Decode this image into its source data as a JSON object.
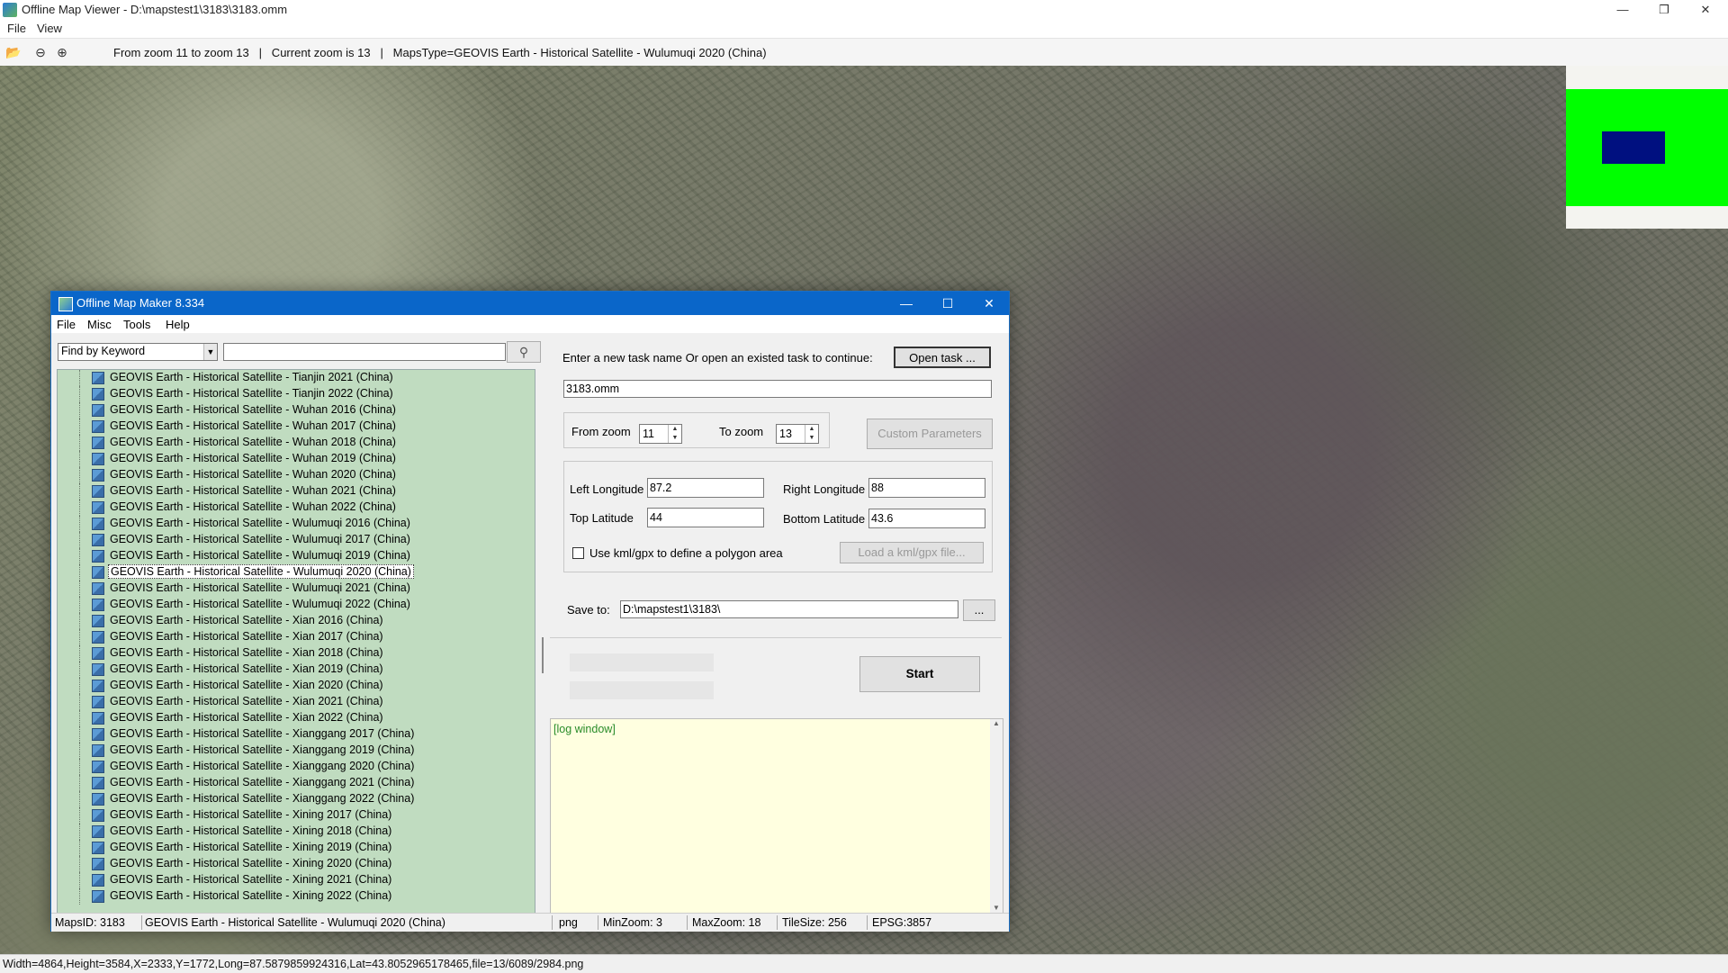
{
  "outer": {
    "title": "Offline Map Viewer - D:\\mapstest1\\3183\\3183.omm",
    "menu": [
      "File",
      "View"
    ],
    "toolbar_status": "From zoom 11 to zoom 13   |   Current zoom is 13   |   MapsType=GEOVIS Earth - Historical Satellite - Wulumuqi 2020 (China)",
    "statusbar": "Width=4864,Height=3584,X=2333,Y=1772,Long=87.5879859924316,Lat=43.8052965178465,file=13/6089/2984.png",
    "controls": [
      "—",
      "❐",
      "✕"
    ]
  },
  "overview": {
    "frame_color": "#00ff00",
    "viewport_color": "#001080"
  },
  "dialog": {
    "title": "Offline Map Maker 8.334",
    "menu": [
      "File",
      "Misc",
      "Tools",
      "Help"
    ],
    "controls": [
      "—",
      "☐",
      "✕"
    ],
    "find": {
      "mode": "Find by Keyword",
      "query": ""
    },
    "tree_items": [
      "GEOVIS Earth - Historical Satellite - Tianjin 2021 (China)",
      "GEOVIS Earth - Historical Satellite - Tianjin 2022 (China)",
      "GEOVIS Earth - Historical Satellite - Wuhan 2016 (China)",
      "GEOVIS Earth - Historical Satellite - Wuhan 2017 (China)",
      "GEOVIS Earth - Historical Satellite - Wuhan 2018 (China)",
      "GEOVIS Earth - Historical Satellite - Wuhan 2019 (China)",
      "GEOVIS Earth - Historical Satellite - Wuhan 2020 (China)",
      "GEOVIS Earth - Historical Satellite - Wuhan 2021 (China)",
      "GEOVIS Earth - Historical Satellite - Wuhan 2022 (China)",
      "GEOVIS Earth - Historical Satellite - Wulumuqi 2016 (China)",
      "GEOVIS Earth - Historical Satellite - Wulumuqi 2017 (China)",
      "GEOVIS Earth - Historical Satellite - Wulumuqi 2019 (China)",
      "GEOVIS Earth - Historical Satellite - Wulumuqi 2020 (China)",
      "GEOVIS Earth - Historical Satellite - Wulumuqi 2021 (China)",
      "GEOVIS Earth - Historical Satellite - Wulumuqi 2022 (China)",
      "GEOVIS Earth - Historical Satellite - Xian 2016 (China)",
      "GEOVIS Earth - Historical Satellite - Xian 2017 (China)",
      "GEOVIS Earth - Historical Satellite - Xian 2018 (China)",
      "GEOVIS Earth - Historical Satellite - Xian 2019 (China)",
      "GEOVIS Earth - Historical Satellite - Xian 2020 (China)",
      "GEOVIS Earth - Historical Satellite - Xian 2021 (China)",
      "GEOVIS Earth - Historical Satellite - Xian 2022 (China)",
      "GEOVIS Earth - Historical Satellite - Xianggang 2017 (China)",
      "GEOVIS Earth - Historical Satellite - Xianggang 2019 (China)",
      "GEOVIS Earth - Historical Satellite - Xianggang 2020 (China)",
      "GEOVIS Earth - Historical Satellite - Xianggang 2021 (China)",
      "GEOVIS Earth - Historical Satellite - Xianggang 2022 (China)",
      "GEOVIS Earth - Historical Satellite - Xining 2017 (China)",
      "GEOVIS Earth - Historical Satellite - Xining 2018 (China)",
      "GEOVIS Earth - Historical Satellite - Xining 2019 (China)",
      "GEOVIS Earth - Historical Satellite - Xining 2020 (China)",
      "GEOVIS Earth - Historical Satellite - Xining 2021 (China)",
      "GEOVIS Earth - Historical Satellite - Xining 2022 (China)"
    ],
    "selected_item": "GEOVIS Earth - Historical Satellite - Wulumuqi 2020 (China)",
    "task_prompt": "Enter a new task name Or open an existed task to continue:",
    "open_task_label": "Open task ...",
    "task_name": "3183.omm",
    "from_zoom_label": "From zoom",
    "from_zoom": "11",
    "to_zoom_label": "To zoom",
    "to_zoom": "13",
    "custom_params_label": "Custom Parameters",
    "left_lon_label": "Left Longitude",
    "left_lon": "87.2",
    "right_lon_label": "Right Longitude",
    "right_lon": "88",
    "top_lat_label": "Top Latitude",
    "top_lat": "44",
    "bottom_lat_label": "Bottom Latitude",
    "bottom_lat": "43.6",
    "kml_label": "Use kml/gpx to define a polygon area",
    "load_kml_label": "Load a kml/gpx file...",
    "save_to_label": "Save to:",
    "save_to": "D:\\mapstest1\\3183\\",
    "browse_label": "...",
    "start_label": "Start",
    "log_text": "[log window]",
    "status": {
      "maps_id": "MapsID: 3183",
      "maps_name": "GEOVIS Earth - Historical Satellite - Wulumuqi 2020 (China)",
      "format": "png",
      "min_zoom": "MinZoom: 3",
      "max_zoom": "MaxZoom: 18",
      "tile_size": "TileSize: 256",
      "epsg": "EPSG:3857"
    }
  }
}
